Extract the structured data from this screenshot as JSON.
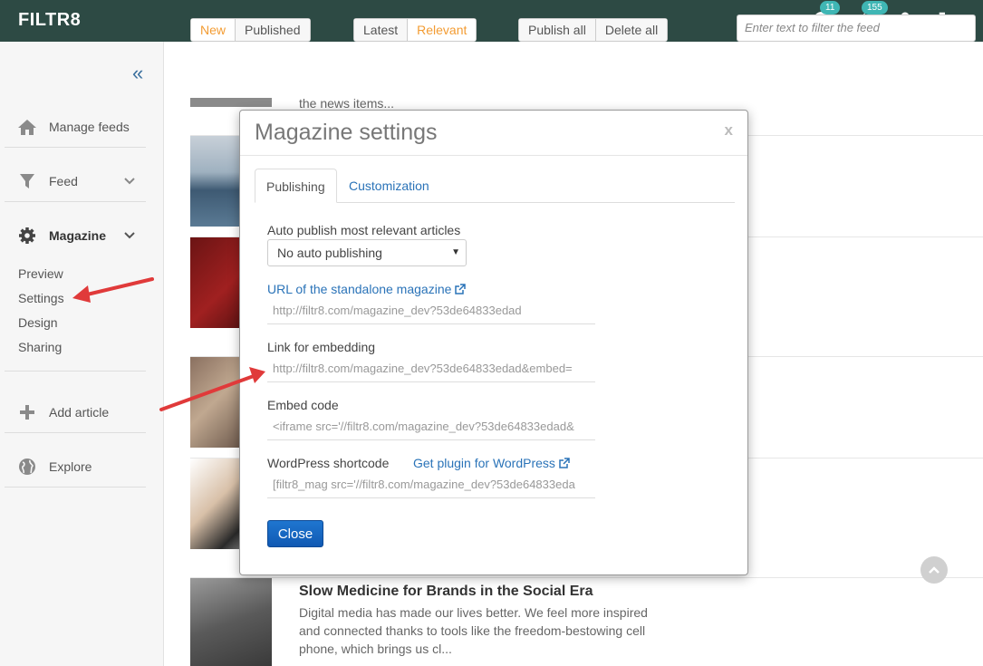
{
  "app": {
    "brand": "FILTR8"
  },
  "topbar": {
    "help_badge": "11",
    "rocket_badge": "155",
    "icons": [
      "question-icon",
      "rocket-icon",
      "user-icon",
      "logout-icon"
    ]
  },
  "sidebar": {
    "items": [
      {
        "label": "Manage feeds",
        "icon": "home-icon"
      },
      {
        "label": "Feed",
        "icon": "filter-icon"
      },
      {
        "label": "Magazine",
        "icon": "gear-icon"
      },
      {
        "label": "Add article",
        "icon": "plus-icon"
      },
      {
        "label": "Explore",
        "icon": "globe-icon"
      }
    ],
    "magazine_sub": [
      "Preview",
      "Settings",
      "Design",
      "Sharing"
    ]
  },
  "toolbar": {
    "new_label": "New",
    "published_label": "Published",
    "latest_label": "Latest",
    "relevant_label": "Relevant",
    "publish_all_label": "Publish all",
    "delete_all_label": "Delete all",
    "filter_placeholder": "Enter text to filter the feed"
  },
  "feed": {
    "snippet_top": "the news items...",
    "last_article": {
      "title": "Slow Medicine for Brands in the Social Era",
      "body": "Digital media has made our lives better. We feel more inspired and connected thanks to tools like the freedom-bestowing cell phone, which brings us cl..."
    }
  },
  "modal": {
    "title": "Magazine settings",
    "close_x": "x",
    "tabs": [
      "Publishing",
      "Customization"
    ],
    "auto_publish_label": "Auto publish most relevant articles",
    "auto_publish_value": "No auto publishing",
    "url_link": "URL of the standalone magazine",
    "url_value": "http://filtr8.com/magazine_dev?53de64833edad",
    "embed_link_label": "Link for embedding",
    "embed_link_value": "http://filtr8.com/magazine_dev?53de64833edad&embed=",
    "embed_code_label": "Embed code",
    "embed_code_value": "<iframe src='//filtr8.com/magazine_dev?53de64833edad&",
    "wp_label": "WordPress shortcode",
    "wp_plugin_link": "Get plugin for WordPress",
    "wp_value": "[filtr8_mag src='//filtr8.com/magazine_dev?53de64833eda",
    "close_button": "Close"
  }
}
